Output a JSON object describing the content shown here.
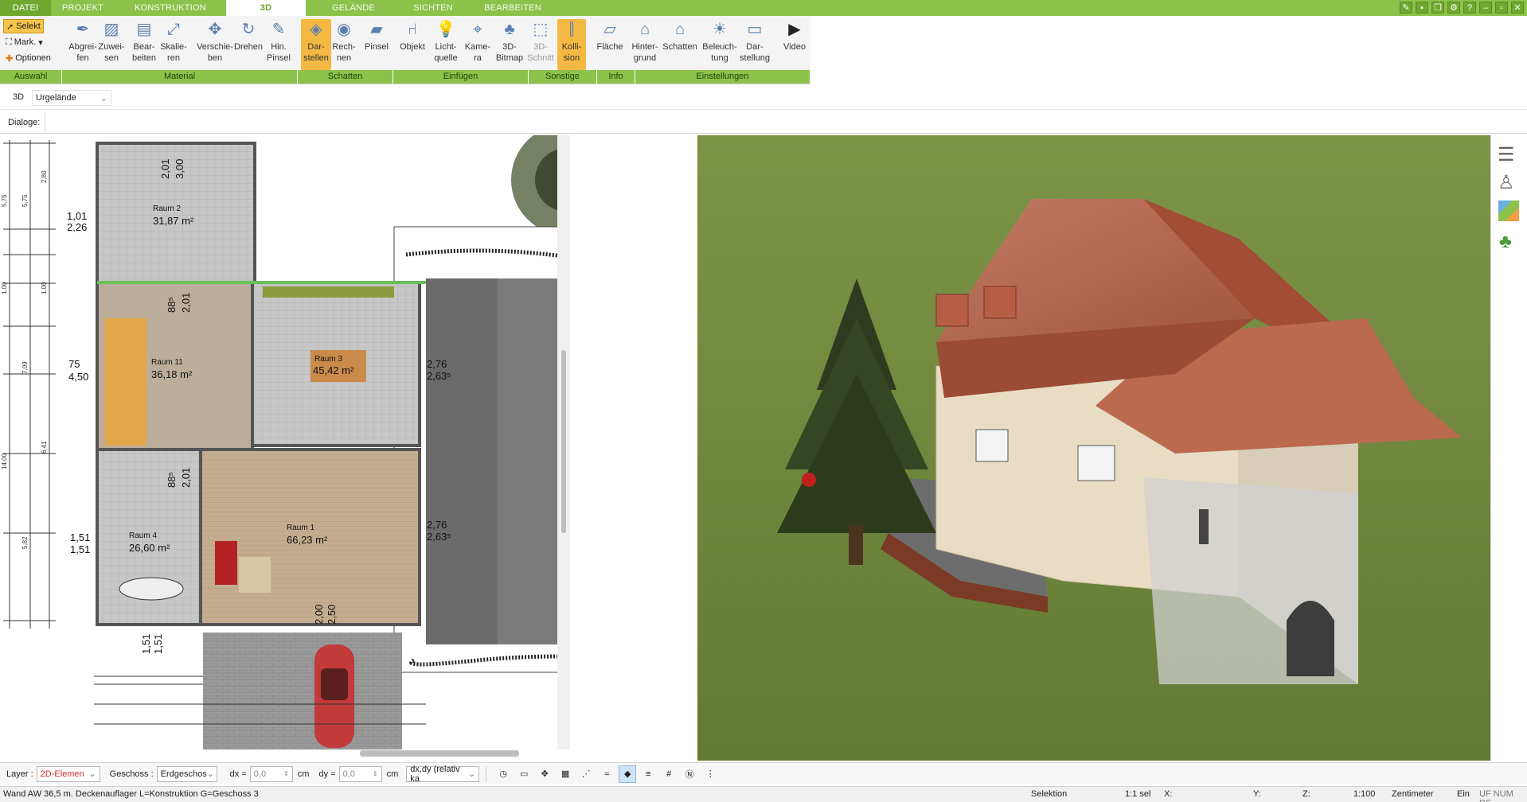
{
  "menu": {
    "tabs": [
      "DATEI",
      "PROJEKT",
      "KONSTRUKTION",
      "3D",
      "GELÄNDE",
      "SICHTEN",
      "BEARBEITEN"
    ],
    "active_tab": "3D"
  },
  "ribbon": {
    "select_buttons": [
      "Selekt",
      "Mark.",
      "Optionen"
    ],
    "buttons": [
      {
        "label": "Abgrei-\nfen",
        "icon": "eyedropper-icon"
      },
      {
        "label": "Zuwei-\nsen",
        "icon": "assign-material-icon"
      },
      {
        "label": "Bear-\nbeiten",
        "icon": "edit-material-icon"
      },
      {
        "label": "Skalie-\nren",
        "icon": "scale-icon"
      },
      {
        "label": "Verschie-\nben",
        "icon": "move-icon"
      },
      {
        "label": "Drehen",
        "icon": "rotate-icon"
      },
      {
        "label": "Hin.\nPinsel",
        "icon": "brush-icon"
      },
      {
        "label": "Dar-\nstellen",
        "icon": "shadow-display-icon"
      },
      {
        "label": "Rech-\nnen",
        "icon": "shadow-calc-icon"
      },
      {
        "label": "Pinsel",
        "icon": "shadow-brush-icon"
      },
      {
        "label": "Objekt",
        "icon": "chair-icon"
      },
      {
        "label": "Licht-\nquelle",
        "icon": "bulb-icon"
      },
      {
        "label": "Kame-\nra",
        "icon": "camera-icon"
      },
      {
        "label": "3D-\nBitmap",
        "icon": "tree-icon"
      },
      {
        "label": "3D-\nSchnitt",
        "icon": "section-icon"
      },
      {
        "label": "Kolli-\nsion",
        "icon": "collision-icon"
      },
      {
        "label": "Fläche",
        "icon": "area-info-icon"
      },
      {
        "label": "Hinter-\ngrund",
        "icon": "background-icon"
      },
      {
        "label": "Schatten",
        "icon": "house-shadow-icon"
      },
      {
        "label": "Beleuch-\ntung",
        "icon": "lighting-icon"
      },
      {
        "label": "Dar-\nstellung",
        "icon": "display-icon"
      },
      {
        "label": "Video",
        "icon": "play-icon"
      }
    ],
    "groups": [
      "Auswahl",
      "Material",
      "Schatten",
      "Einfügen",
      "Sonstige",
      "Info",
      "Einstellungen"
    ]
  },
  "view": {
    "mode": "3D",
    "selector": "Urgelände",
    "dialog_label": "Dialoge:"
  },
  "plan": {
    "rooms": [
      {
        "name": "Raum 2",
        "area": "31,87 m²"
      },
      {
        "name": "Raum 11",
        "area": "36,18 m²"
      },
      {
        "name": "Raum 3",
        "area": "45,42 m²"
      },
      {
        "name": "Raum 4",
        "area": "26,60 m²"
      },
      {
        "name": "Raum 1",
        "area": "66,23 m²"
      }
    ],
    "dimensions": [
      "2,01",
      "3,00",
      "1,01",
      "2,26",
      "75",
      "4,50",
      "88⁵",
      "2,01",
      "88⁵",
      "2,01",
      "2,76",
      "2,63⁵",
      "2,76",
      "2,63⁵",
      "1,51",
      "1,51",
      "2,00",
      "2,50",
      "1,51",
      "1,51"
    ],
    "ruler_left": [
      "5,75",
      "5,75",
      "1,00",
      "1,00",
      "7,09",
      "14,00",
      "6,41",
      "5,82",
      "2,80"
    ]
  },
  "toolbar": {
    "layer_label": "Layer :",
    "layer_value": "2D-Elemen",
    "geschoss_label": "Geschoss :",
    "geschoss_value": "Erdgeschos",
    "dx_label": "dx =",
    "dx_value": "0,0",
    "dx_unit": "cm",
    "dy_label": "dy =",
    "dy_value": "0,0",
    "dy_unit": "cm",
    "mode_value": "dx,dy (relativ ka"
  },
  "status": {
    "message": "Wand AW 36,5 m. Deckenauflager L=Konstruktion G=Geschoss 3",
    "mode": "Selektion",
    "sel": "1:1 sel",
    "x": "X:",
    "y": "Y:",
    "z": "Z:",
    "scale": "1:100",
    "unit": "Zentimeter",
    "ein": "Ein",
    "flags": "UF NUM RF"
  },
  "colors": {
    "accent": "#8cc24a",
    "active_button": "#f5b842",
    "roof": "#b3624a",
    "grass": "#6f8a3e"
  }
}
